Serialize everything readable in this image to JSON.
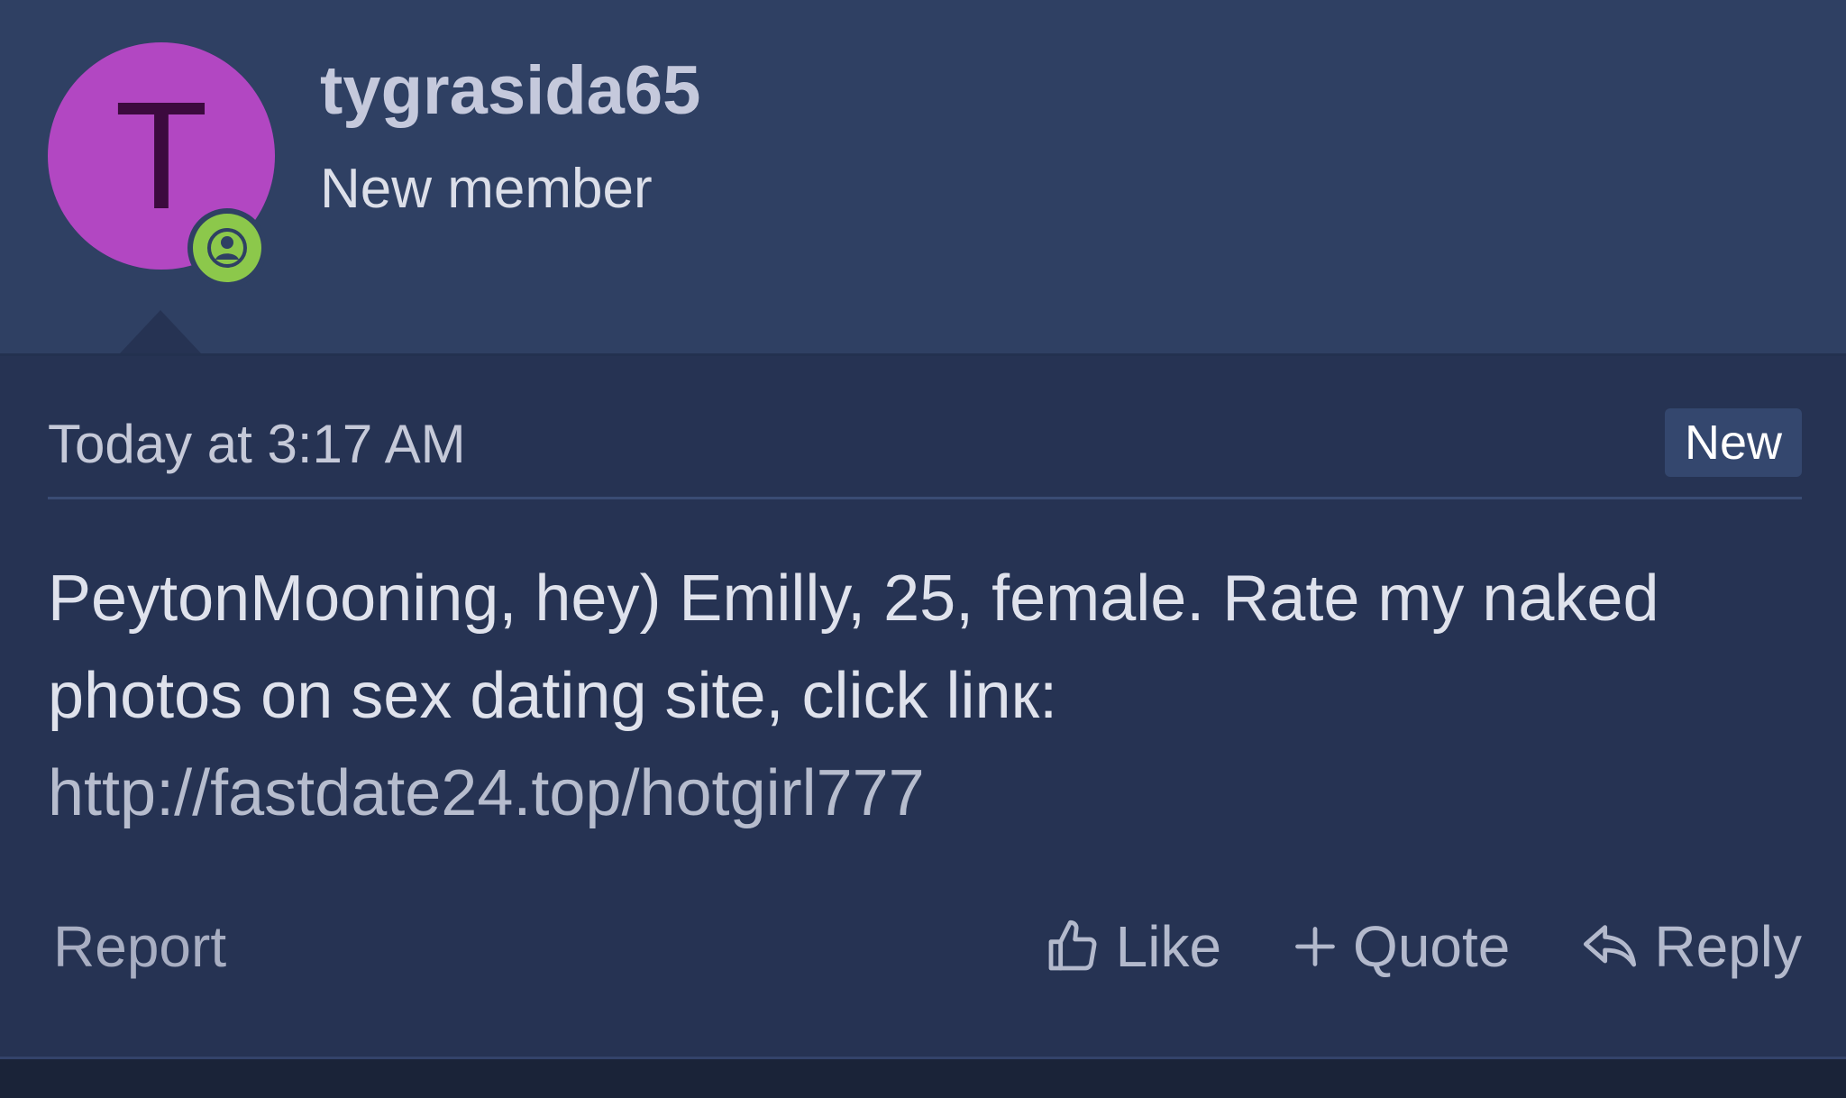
{
  "post": {
    "author": {
      "avatar_letter": "T",
      "avatar_color": "#b247c2",
      "username": "tygrasida65",
      "user_title": "New member",
      "status_icon": "user-online-icon"
    },
    "timestamp": "Today at 3:17 AM",
    "badge": "New",
    "message": {
      "text": "PeytonMooning, hey) Emilly, 25, female. Rate my naked photos on sex dating site, click linк:",
      "link": "http://fastdate24.top/hotgirl777"
    },
    "footer": {
      "report_label": "Report",
      "like_label": "Like",
      "like_icon": "thumbs-up-icon",
      "quote_label": "Quote",
      "quote_icon": "plus-icon",
      "reply_label": "Reply",
      "reply_icon": "reply-arrow-icon"
    }
  },
  "colors": {
    "header_bg": "#2f4063",
    "body_bg": "#263353",
    "status_green": "#8cc84b"
  }
}
